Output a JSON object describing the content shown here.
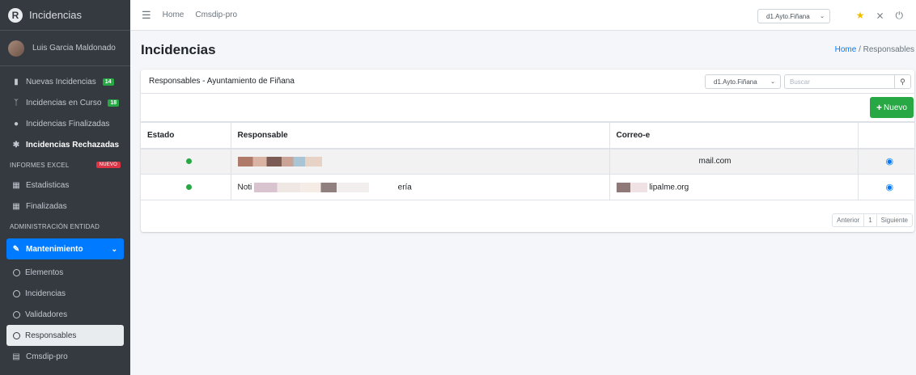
{
  "brand": {
    "title": "Incidencias",
    "logo_letter": "R"
  },
  "user": {
    "name": "Luis Garcia Maldonado"
  },
  "sidebar": {
    "items": [
      {
        "label": "Nuevas Incidencias",
        "badge": "14",
        "icon": "bookmark-icon"
      },
      {
        "label": "Incidencias en Curso",
        "badge": "18",
        "icon": "branch-icon"
      },
      {
        "label": "Incidencias Finalizadas",
        "icon": "bookmark-icon"
      },
      {
        "label": "Incidencias Rechazadas",
        "icon": "user-block-icon"
      }
    ],
    "header_excel": "INFORMES EXCEL",
    "header_excel_badge": "Nuevo",
    "excel_items": [
      {
        "label": "Estadisticas",
        "icon": "file-excel-icon"
      },
      {
        "label": "Finalizadas",
        "icon": "file-excel-icon"
      }
    ],
    "header_admin": "ADMINISTRACIÓN ENTIDAD",
    "mantenimiento": "Mantenimiento",
    "sub_items": [
      "Elementos",
      "Incidencias",
      "Validadores",
      "Responsables"
    ],
    "last_item": "Cmsdip-pro"
  },
  "topbar": {
    "home": "Home",
    "cmsdip": "Cmsdip-pro",
    "entity_select": "d1.Ayto.Fiñana"
  },
  "page": {
    "title": "Incidencias",
    "breadcrumb_home": "Home",
    "breadcrumb_sep": "/",
    "breadcrumb_current": "Responsables"
  },
  "card": {
    "title": "Responsables - Ayuntamiento de Fiñana",
    "entity_select": "d1.Ayto.Fiñana",
    "search_placeholder": "Buscar",
    "new_button": "Nuevo"
  },
  "table": {
    "headers": [
      "Estado",
      "Responsable",
      "Correo-e",
      ""
    ],
    "rows": [
      {
        "responsable": "",
        "correo": "mail.com"
      },
      {
        "responsable_start": "Noti",
        "responsable_end": "ería",
        "correo": "lipalme.org"
      }
    ]
  },
  "pagination": {
    "prev": "Anterior",
    "page": "1",
    "next": "Siguiente"
  },
  "colors": {
    "primary": "#007bff",
    "success": "#28a745",
    "sidebar": "#343a40"
  }
}
